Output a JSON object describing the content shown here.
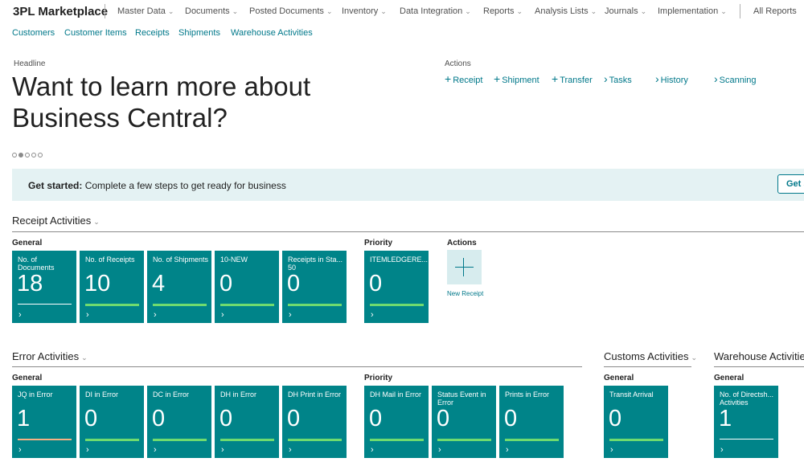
{
  "app": {
    "title": "3PL Marketplace"
  },
  "nav": {
    "menus": [
      "Master Data",
      "Documents",
      "Posted Documents",
      "Inventory",
      "Data Integration",
      "Reports",
      "Analysis Lists",
      "Journals",
      "Implementation"
    ],
    "all_reports": "All Reports"
  },
  "subnav": [
    "Customers",
    "Customer Items",
    "Receipts",
    "Shipments",
    "Warehouse Activities"
  ],
  "headline": {
    "label": "Headline",
    "text": "Want to learn more about Business Central?",
    "pages": 5,
    "active_page": 2
  },
  "actions": {
    "label": "Actions",
    "items": [
      {
        "glyph": "+",
        "label": "Receipt"
      },
      {
        "glyph": "+",
        "label": "Shipment"
      },
      {
        "glyph": "+",
        "label": "Transfer"
      },
      {
        "glyph": "›",
        "label": "Tasks"
      },
      {
        "glyph": "›",
        "label": "History"
      },
      {
        "glyph": "›",
        "label": "Scanning"
      }
    ]
  },
  "banner": {
    "bold": "Get started:",
    "text": "Complete a few steps to get ready for business",
    "button": "Get s"
  },
  "receipt": {
    "title": "Receipt Activities",
    "general_label": "General",
    "priority_label": "Priority",
    "actions_label": "Actions",
    "tiles": [
      {
        "label": "No. of Documents",
        "value": "18",
        "bar": "white"
      },
      {
        "label": "No. of Receipts",
        "value": "10",
        "bar": "green"
      },
      {
        "label": "No. of Shipments",
        "value": "4",
        "bar": "green"
      },
      {
        "label": "10-NEW",
        "value": "0",
        "bar": "green"
      },
      {
        "label": "Receipts in Sta... 50",
        "value": "0",
        "bar": "green"
      }
    ],
    "priority_tiles": [
      {
        "label": "ITEMLEDGERE...",
        "value": "0",
        "bar": "green"
      }
    ],
    "new_receipt": "New Receipt"
  },
  "error": {
    "title": "Error Activities",
    "general_label": "General",
    "priority_label": "Priority",
    "tiles": [
      {
        "label": "JQ in Error",
        "value": "1",
        "bar": "orange"
      },
      {
        "label": "DI in Error",
        "value": "0",
        "bar": "green"
      },
      {
        "label": "DC in Error",
        "value": "0",
        "bar": "green"
      },
      {
        "label": "DH in Error",
        "value": "0",
        "bar": "green"
      },
      {
        "label": "DH Print in Error",
        "value": "0",
        "bar": "green"
      }
    ],
    "priority_tiles": [
      {
        "label": "DH Mail in Error",
        "value": "0",
        "bar": "green"
      },
      {
        "label": "Status Event in Error",
        "value": "0",
        "bar": "green"
      },
      {
        "label": "Prints in Error",
        "value": "0",
        "bar": "green"
      }
    ]
  },
  "customs": {
    "title": "Customs Activities",
    "general_label": "General",
    "tiles": [
      {
        "label": "Transit Arrival",
        "value": "0",
        "bar": "green"
      }
    ]
  },
  "warehouse": {
    "title": "Warehouse Activities",
    "general_label": "General",
    "tiles": [
      {
        "label": "No. of Directsh... Activities",
        "value": "1",
        "bar": "white"
      }
    ]
  },
  "colors": {
    "tile": "#008489",
    "accent": "#00788a",
    "bar_ok": "#6fdb6f",
    "bar_warn": "#f3b183",
    "banner": "#e4f2f3"
  },
  "icons": {
    "chevron": "chevron-down-icon",
    "tile_drill": "chevron-right-icon",
    "add": "plus-icon"
  }
}
